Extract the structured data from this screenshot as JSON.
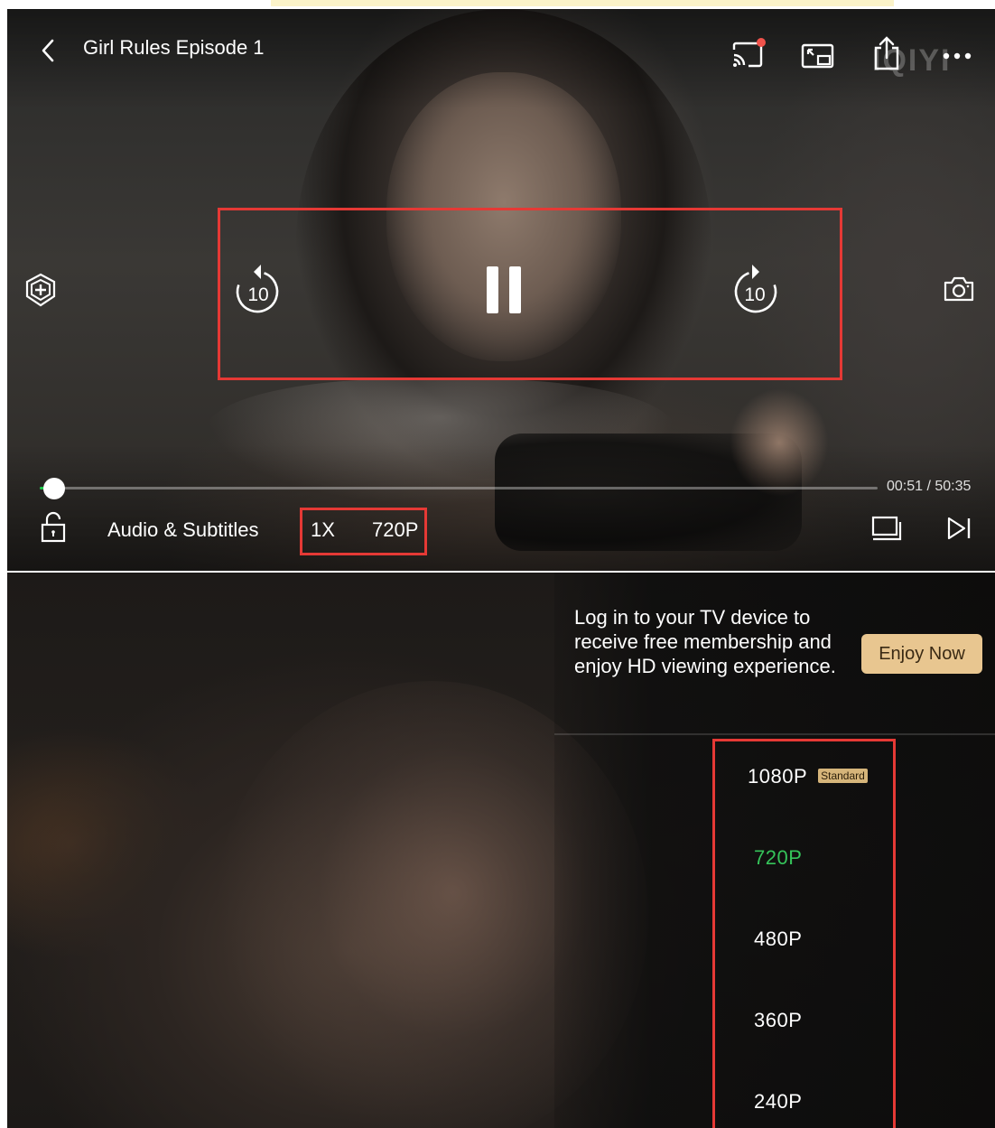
{
  "player": {
    "title": "Girl Rules Episode 1",
    "watermark": "IQIYI",
    "time_display": "00:51 / 50:35",
    "progress_fraction": 0.017,
    "controls": {
      "audio_subtitles": "Audio & Subtitles",
      "speed": "1X",
      "quality": "720P",
      "rewind_seconds": "10",
      "forward_seconds": "10"
    },
    "icons": [
      "back-icon",
      "cast-icon",
      "picture-in-picture-icon",
      "share-icon",
      "more-icon",
      "ai-lens-icon",
      "rewind-10-icon",
      "pause-icon",
      "forward-10-icon",
      "screenshot-icon",
      "lock-icon",
      "episodes-icon",
      "next-episode-icon"
    ],
    "accent_color": "#1cc749",
    "highlight_color": "#e53935"
  },
  "quality_menu": {
    "promo_text": "Log in to your TV device to receive free membership and enjoy HD viewing experience.",
    "promo_button": "Enjoy Now",
    "options": [
      {
        "label": "1080P",
        "badge": "Standard"
      },
      {
        "label": "720P",
        "selected": true
      },
      {
        "label": "480P"
      },
      {
        "label": "360P"
      },
      {
        "label": "240P"
      }
    ],
    "selected_color": "#35c45a",
    "button_color": "#e8c690"
  }
}
